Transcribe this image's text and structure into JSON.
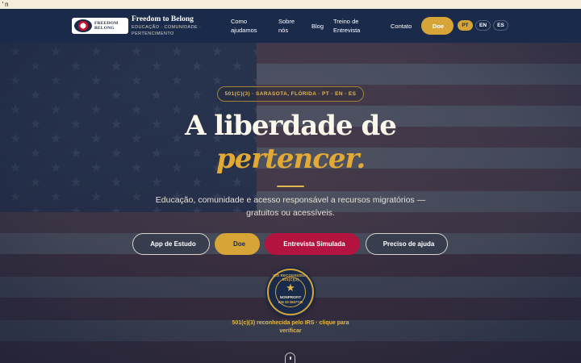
{
  "stray_text": "'n",
  "nav": {
    "logo_text": [
      "FREEDOM",
      "BELONG"
    ],
    "brand_name": "Freedom to Belong",
    "brand_tagline": "EDUCAÇÃO · COMUNIDADE · PERTENCIMENTO",
    "links": {
      "como_ajudamos_1": "Como",
      "como_ajudamos_2": "ajudamos",
      "sobre_1": "Sobre",
      "sobre_2": "nós",
      "blog": "Blog",
      "treino_1": "Treino de",
      "treino_2": "Entrevista",
      "contato": "Contato"
    },
    "donate_icon": "",
    "donate_label": "Doe",
    "languages": [
      "PT",
      "EN",
      "ES"
    ],
    "active_language": "PT"
  },
  "hero": {
    "badge": "501(C)(3) · SARASOTA, FLÓRIDA · PT · EN · ES",
    "headline_line1": "A liberdade de",
    "headline_line2": "pertencer.",
    "subtitle": "Educação, comunidade e acesso responsável a recursos migratórios — gratuitos ou acessíveis.",
    "buttons": {
      "study_app": "App de Estudo",
      "donate": "Doe",
      "mock_interview": "Entrevista Simulada",
      "need_help": "Preciso de ajuda"
    },
    "button_icon_glyph": "",
    "seal": {
      "top": "IRS RECOGNIZED · 501(C)(3)",
      "star": "★",
      "middle": "NONPROFIT",
      "bottom": "EIN 33-3607743"
    },
    "seal_caption": "501(c)(3) reconhecida pelo IRS · clique para verificar"
  },
  "colors": {
    "navy": "#1a2a4b",
    "gold": "#d6a437",
    "crimson": "#b3133f",
    "cream": "#fbf6ea"
  }
}
